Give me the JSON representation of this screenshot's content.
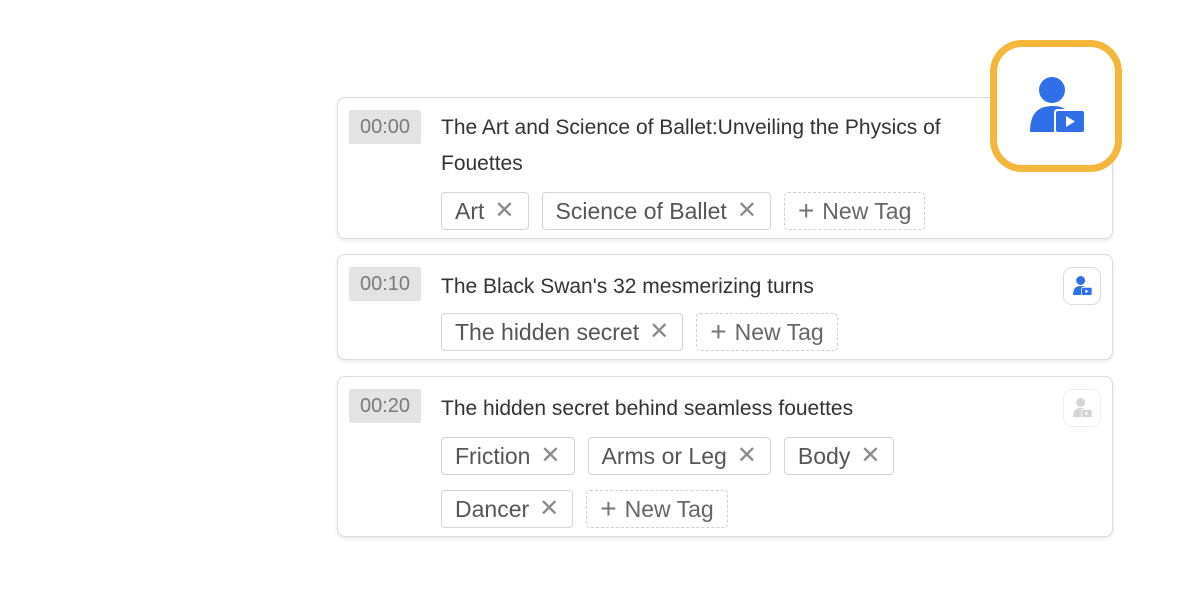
{
  "colors": {
    "accent": "#2f6fe8",
    "highlight": "#f5b73b",
    "disabled_icon": "#d4d4d4"
  },
  "new_tag_label": "New Tag",
  "remove_glyph": "✕",
  "plus_glyph": "+",
  "highlighted_action": {
    "icon": "person-video-icon"
  },
  "segments": [
    {
      "time": "00:00",
      "title": "The Art and Science of Ballet:Unveiling the Physics of Fouettes",
      "tags": [
        "Art",
        "Science of Ballet"
      ],
      "action_icon": "person-video-icon",
      "action_state": "highlighted"
    },
    {
      "time": "00:10",
      "title": "The Black Swan's 32 mesmerizing turns",
      "tags": [
        "The hidden secret"
      ],
      "action_icon": "person-video-icon",
      "action_state": "active"
    },
    {
      "time": "00:20",
      "title": "The hidden secret behind seamless fouettes",
      "tags": [
        "Friction",
        "Arms or Leg",
        "Body",
        "Dancer"
      ],
      "action_icon": "person-video-icon",
      "action_state": "disabled"
    }
  ]
}
